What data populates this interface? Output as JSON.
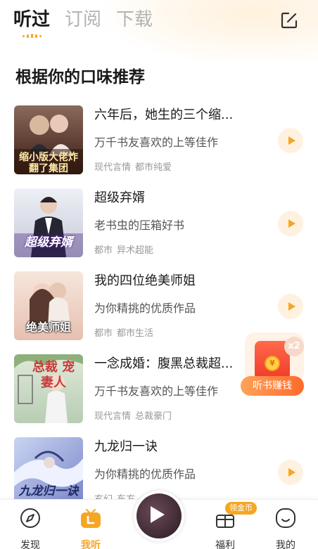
{
  "header": {
    "tabs": [
      {
        "label": "听过",
        "active": true
      },
      {
        "label": "订阅",
        "active": false
      },
      {
        "label": "下载",
        "active": false
      }
    ],
    "edit_icon": "edit-square-icon",
    "accent_color": "#f5a623"
  },
  "section": {
    "title": "根据你的口味推荐"
  },
  "books": [
    {
      "title": "六年后，她生的三个缩...",
      "description": "万千书友喜欢的上等佳作",
      "tags": [
        "现代言情",
        "都市纯爱"
      ],
      "cover_text": "缩小版大佬炸翻了集团"
    },
    {
      "title": "超级弃婿",
      "description": "老书虫的压箱好书",
      "tags": [
        "都市",
        "异术超能"
      ],
      "cover_text": "超级弃婿"
    },
    {
      "title": "我的四位绝美师姐",
      "description": "为你精挑的优质作品",
      "tags": [
        "都市",
        "都市生活"
      ],
      "cover_text": "绝美师姐"
    },
    {
      "title": "一念成婚：腹黑总裁超...",
      "description": "万千书友喜欢的上等佳作",
      "tags": [
        "现代言情",
        "总裁豪门"
      ],
      "cover_text": "总裁 宠妻人"
    },
    {
      "title": "九龙归一诀",
      "description": "为你精挑的优质作品",
      "tags": [
        "玄幻",
        "东方"
      ],
      "cover_text": "九龙归一诀"
    }
  ],
  "reward_widget": {
    "multiplier": "x2",
    "label": "听书赚钱",
    "coin_symbol": "¥"
  },
  "bottom_nav": {
    "items": [
      {
        "label": "发现",
        "icon": "compass-icon",
        "active": false
      },
      {
        "label": "我听",
        "icon": "radio-icon",
        "active": true
      },
      {
        "label": "福利",
        "icon": "gift-icon",
        "active": false
      },
      {
        "label": "我的",
        "icon": "smile-icon",
        "active": false
      }
    ],
    "coin_badge": "领金币"
  }
}
